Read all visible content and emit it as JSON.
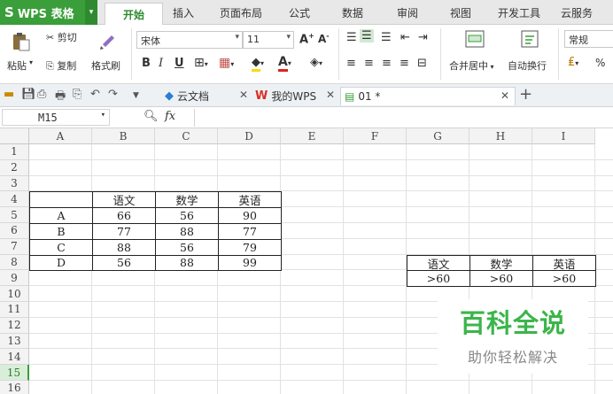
{
  "app": {
    "name": "WPS 表格"
  },
  "menu_tabs": [
    "开始",
    "插入",
    "页面布局",
    "公式",
    "数据",
    "审阅",
    "视图",
    "开发工具",
    "云服务"
  ],
  "ribbon": {
    "paste": "粘贴",
    "cut": "剪切",
    "copy": "复制",
    "format_painter": "格式刷",
    "font_name": "宋体",
    "font_size": "11",
    "merge_center": "合并居中",
    "wrap_text": "自动换行",
    "number_format": "常规",
    "percent": "%"
  },
  "doc_tabs": [
    {
      "label": "云文档"
    },
    {
      "label": "我的WPS"
    },
    {
      "label": "01 *"
    }
  ],
  "formula_bar": {
    "cell_ref": "M15",
    "fx": "fx",
    "content": ""
  },
  "columns": [
    "A",
    "B",
    "C",
    "D",
    "E",
    "F",
    "G",
    "H",
    "I"
  ],
  "rows": [
    "1",
    "2",
    "3",
    "4",
    "5",
    "6",
    "7",
    "8",
    "9",
    "10",
    "11",
    "12",
    "13",
    "14",
    "15",
    "16"
  ],
  "selected_row": "15",
  "table1": {
    "headers": [
      "语文",
      "数学",
      "英语"
    ],
    "rows": [
      {
        "name": "A",
        "values": [
          "66",
          "56",
          "90"
        ]
      },
      {
        "name": "B",
        "values": [
          "77",
          "88",
          "77"
        ]
      },
      {
        "name": "C",
        "values": [
          "88",
          "56",
          "79"
        ]
      },
      {
        "name": "D",
        "values": [
          "56",
          "88",
          "99"
        ]
      }
    ]
  },
  "table2": {
    "headers": [
      "语文",
      "数学",
      "英语"
    ],
    "criteria": [
      ">60",
      ">60",
      ">60"
    ]
  },
  "watermark": {
    "title": "百科全说",
    "subtitle": "助你轻松解决"
  },
  "colors": {
    "accent": "#3a9e3a",
    "watermark_green": "#3bb54a"
  }
}
